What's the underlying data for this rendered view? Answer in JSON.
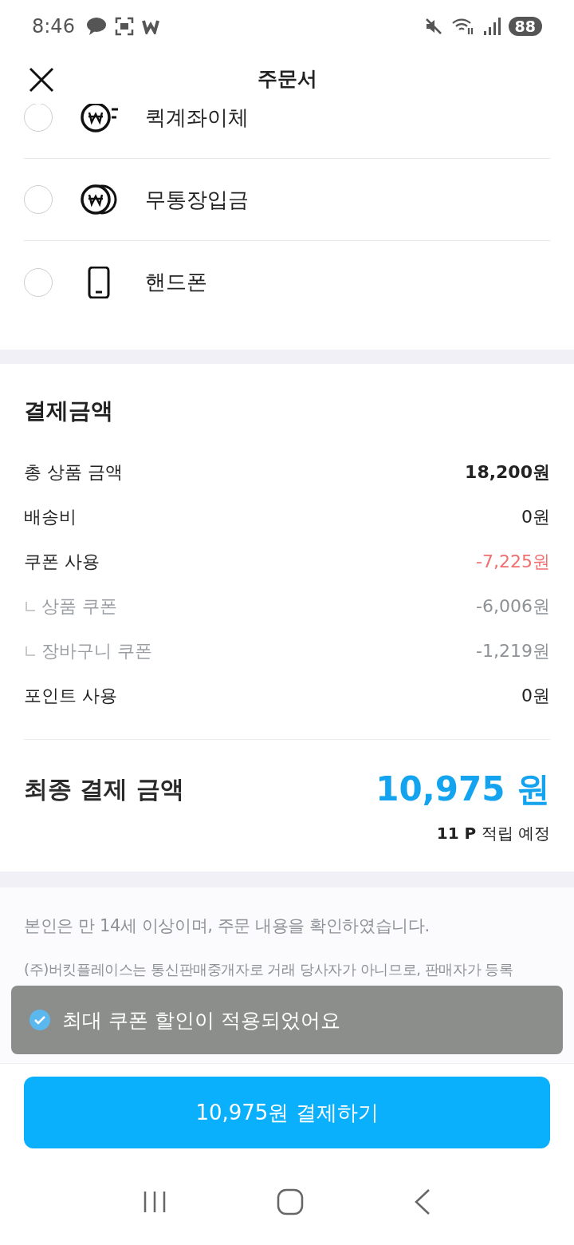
{
  "status_bar": {
    "time": "8:46",
    "battery": "88"
  },
  "header": {
    "title": "주문서"
  },
  "payment_methods": [
    {
      "label": "퀵계좌이체",
      "kind": "quick",
      "selected": false
    },
    {
      "label": "무통장입금",
      "kind": "won",
      "selected": false
    },
    {
      "label": "핸드폰",
      "kind": "phone",
      "selected": false
    }
  ],
  "payment_summary": {
    "title": "결제금액",
    "rows": [
      {
        "label": "총 상품 금액",
        "value": "18,200원",
        "kind": "main",
        "bold": true,
        "color": "#222222"
      },
      {
        "label": "배송비",
        "value": "0원",
        "kind": "main",
        "bold": false,
        "color": "#222222"
      },
      {
        "label": "쿠폰 사용",
        "value": "-7,225원",
        "kind": "main",
        "bold": false,
        "color": "#f07070"
      },
      {
        "label": "상품 쿠폰",
        "value": "-6,006원",
        "kind": "sub",
        "bold": false,
        "color": "#8e9296"
      },
      {
        "label": "장바구니 쿠폰",
        "value": "-1,219원",
        "kind": "sub",
        "bold": false,
        "color": "#8e9296"
      },
      {
        "label": "포인트 사용",
        "value": "0원",
        "kind": "main",
        "bold": false,
        "color": "#222222"
      }
    ],
    "final_label": "최종 결제 금액",
    "final_value": "10,975 원",
    "points": "11 P",
    "points_suffix": "적립 예정"
  },
  "notices": [
    "본인은 만 14세 이상이며, 주문 내용을 확인하였습니다.",
    "(주)버킷플레이스는 통신판매중개자로 거래 당사자가 아니므로, 판매자가 등록"
  ],
  "toast": {
    "message": "최대 쿠폰 할인이 적용되었어요"
  },
  "pay_button": {
    "label": "10,975원 결제하기"
  }
}
